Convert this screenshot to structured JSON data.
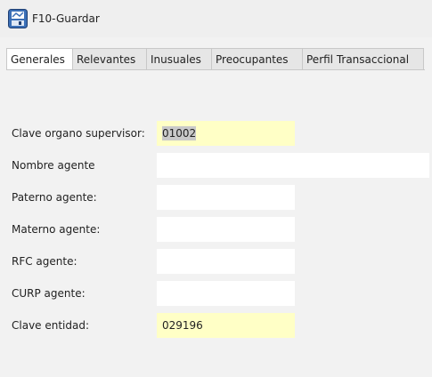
{
  "toolbar": {
    "save_label": "F10-Guardar",
    "save_icon": "save-icon"
  },
  "tabs": [
    {
      "label": "Generales",
      "active": true
    },
    {
      "label": "Relevantes",
      "active": false
    },
    {
      "label": "Inusuales",
      "active": false
    },
    {
      "label": "Preocupantes",
      "active": false
    },
    {
      "label": "Perfil Transaccional",
      "active": false
    }
  ],
  "form": {
    "clave_organo_supervisor": {
      "label": "Clave organo supervisor:",
      "value": "01002"
    },
    "nombre_agente": {
      "label": "Nombre agente",
      "value": ""
    },
    "paterno_agente": {
      "label": "Paterno agente:",
      "value": ""
    },
    "materno_agente": {
      "label": "Materno agente:",
      "value": ""
    },
    "rfc_agente": {
      "label": "RFC agente:",
      "value": ""
    },
    "curp_agente": {
      "label": "CURP agente:",
      "value": ""
    },
    "clave_entidad": {
      "label": "Clave entidad:",
      "value": "029196"
    }
  },
  "colors": {
    "highlight_field": "#ffffc6",
    "background": "#f2f2f2"
  }
}
